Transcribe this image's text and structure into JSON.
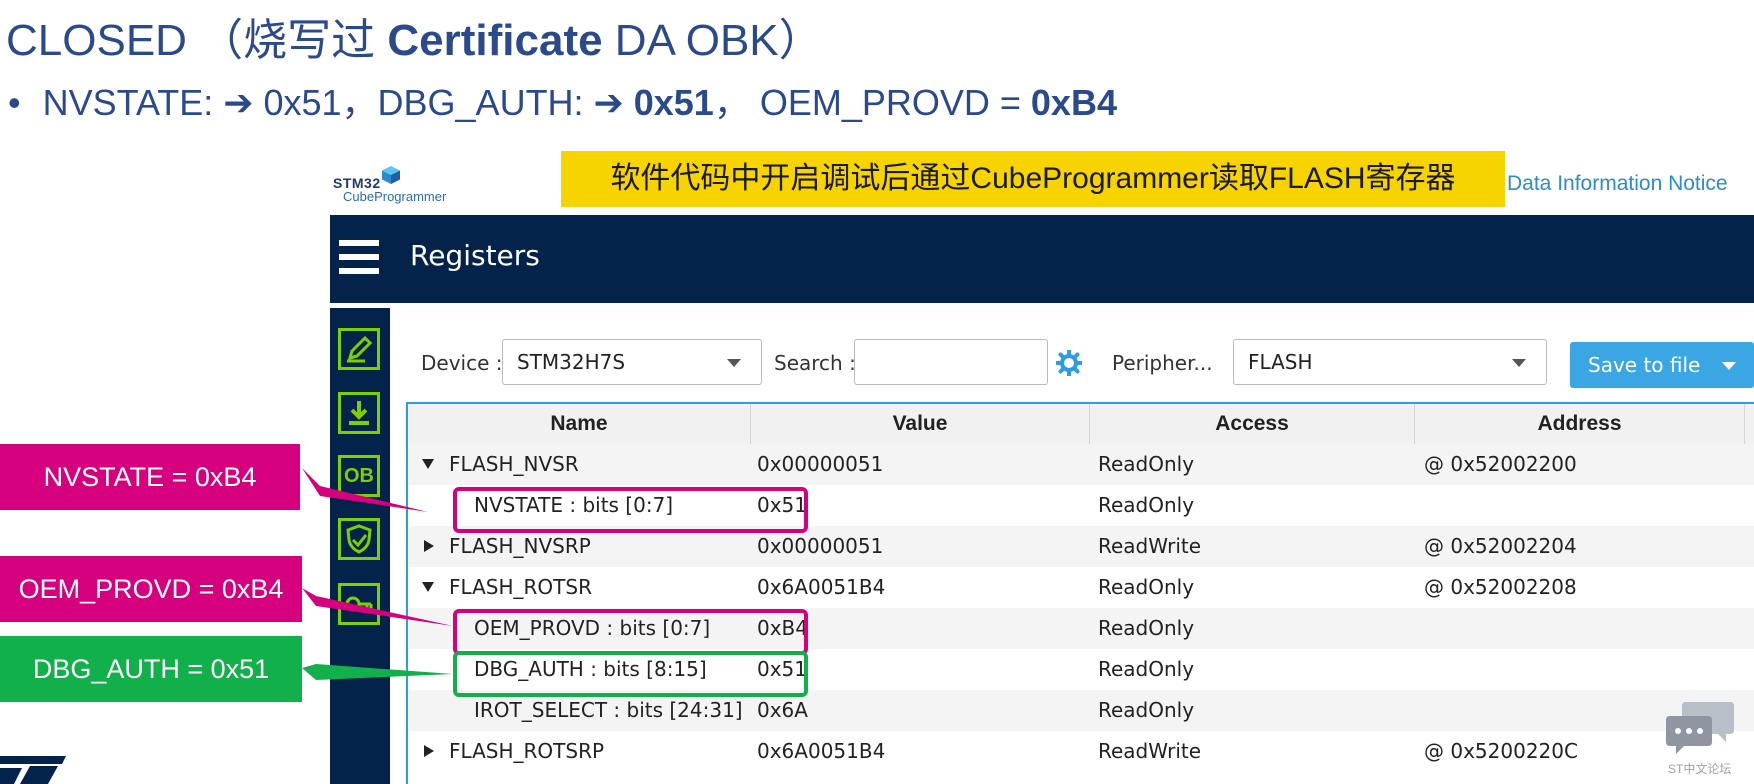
{
  "slide": {
    "title_plain": "CLOSED （烧写过 ",
    "title_bold": "Certificate",
    "title_tail": " DA OBK）",
    "bullet": {
      "part1": "NVSTATE: ➔ 0x51，DBG_AUTH: ➔ ",
      "part2": "0x51",
      "part3": "，  OEM_PROVD = ",
      "part4": "0xB4"
    }
  },
  "logo": {
    "line1": "STM32",
    "line2": "CubeProgrammer"
  },
  "banner": "软件代码中开启调试后通过CubeProgrammer读取FLASH寄存器",
  "notice_link": "Data Information Notice",
  "app": {
    "title": "Registers",
    "sidebar_icons": [
      "edit-icon",
      "download-icon",
      "ob-icon",
      "shield-icon",
      "key-icon"
    ],
    "ob_label": "OB",
    "toolbar": {
      "device_label": "Device :",
      "device_value": "STM32H7S",
      "search_label": "Search :",
      "search_value": "",
      "peripheral_label": "Peripher...",
      "peripheral_value": "FLASH",
      "save_label": "Save to file"
    },
    "table": {
      "headers": [
        "Name",
        "Value",
        "Access",
        "Address"
      ],
      "rows": [
        {
          "name": "FLASH_NVSR",
          "value": "0x00000051",
          "access": "ReadOnly",
          "address": "@ 0x52002200"
        },
        {
          "name": "NVSTATE : bits [0:7]",
          "value": "0x51",
          "access": "ReadOnly",
          "address": ""
        },
        {
          "name": "FLASH_NVSRP",
          "value": "0x00000051",
          "access": "ReadWrite",
          "address": "@ 0x52002204"
        },
        {
          "name": "FLASH_ROTSR",
          "value": "0x6A0051B4",
          "access": "ReadOnly",
          "address": "@ 0x52002208"
        },
        {
          "name": "OEM_PROVD : bits [0:7]",
          "value": "0xB4",
          "access": "ReadOnly",
          "address": ""
        },
        {
          "name": "DBG_AUTH : bits [8:15]",
          "value": "0x51",
          "access": "ReadOnly",
          "address": ""
        },
        {
          "name": "IROT_SELECT : bits [24:31]",
          "value": "0x6A",
          "access": "ReadOnly",
          "address": ""
        },
        {
          "name": "FLASH_ROTSRP",
          "value": "0x6A0051B4",
          "access": "ReadWrite",
          "address": "@ 0x5200220C"
        }
      ]
    }
  },
  "callouts": {
    "nvstate": "NVSTATE = 0xB4",
    "oem": "OEM_PROVD = 0xB4",
    "dbg": "DBG_AUTH = 0x51"
  },
  "forum_text": "ST中文论坛",
  "colors": {
    "app_navy": "#03234b",
    "banner_yellow": "#f7d300",
    "highlight_pink": "#d6007e",
    "highlight_green": "#11b04b",
    "accent_blue": "#2a9ee0"
  }
}
